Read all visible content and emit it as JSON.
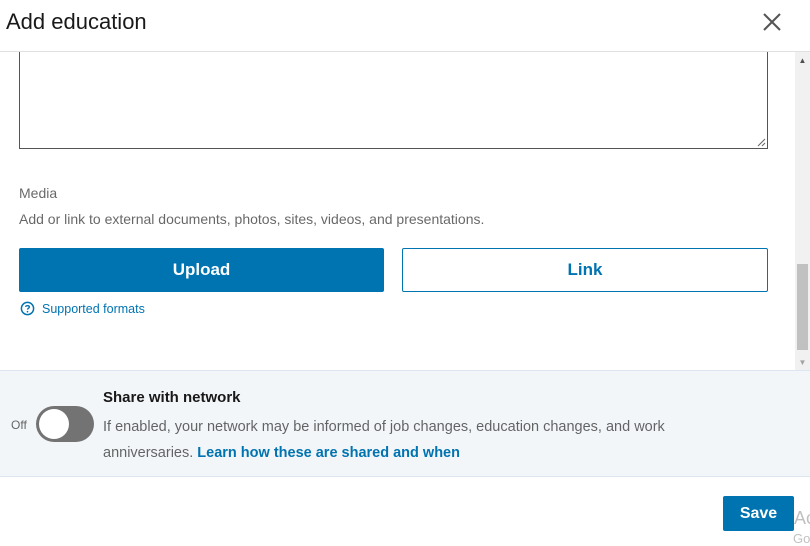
{
  "dialog": {
    "title": "Add education"
  },
  "media": {
    "label": "Media",
    "description": "Add or link to external documents, photos, sites, videos, and presentations.",
    "upload_label": "Upload",
    "link_label": "Link",
    "supported_formats_label": "Supported formats"
  },
  "share": {
    "toggle_state_label": "Off",
    "toggle_on": false,
    "title": "Share with network",
    "description": "If enabled, your network may be informed of job changes, education changes, and work anniversaries.",
    "learn_link": "Learn how these are shared and when"
  },
  "footer": {
    "save_label": "Save"
  },
  "watermark": {
    "line1": "Ac",
    "line2": "Go"
  },
  "colors": {
    "primary": "#0073b1",
    "panel_bg": "#f3f6f8",
    "toggle_off": "#737373"
  },
  "icons": {
    "close": "close-icon",
    "help": "question-circle-icon",
    "resize": "resize-grip-icon",
    "scroll_up": "triangle-up-icon",
    "scroll_down": "triangle-down-icon"
  }
}
